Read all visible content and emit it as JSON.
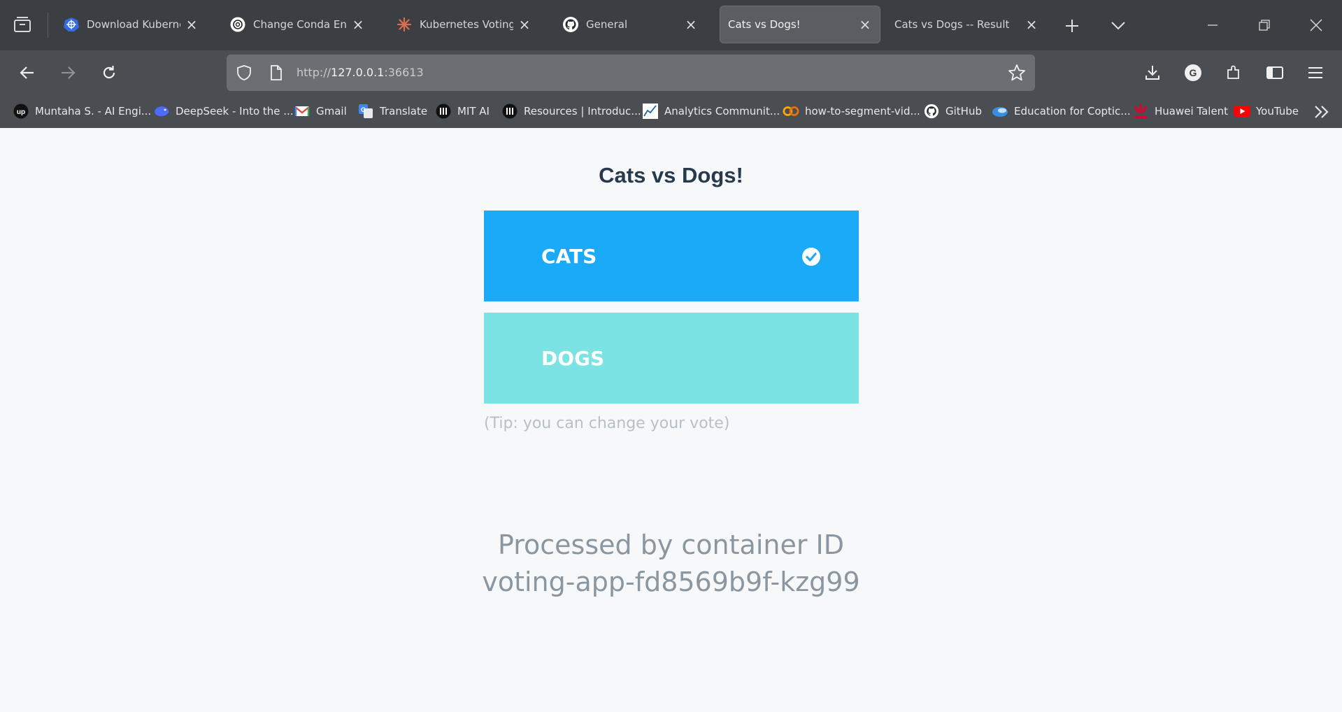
{
  "browser": {
    "tabs": [
      {
        "title": "Download Kubernetes",
        "icon": "kubernetes-icon",
        "active": false
      },
      {
        "title": "Change Conda Environ",
        "icon": "openai-icon",
        "active": false
      },
      {
        "title": "Kubernetes Voting Ap",
        "icon": "claude-icon",
        "active": false
      },
      {
        "title": "General",
        "icon": "github-icon",
        "active": false
      },
      {
        "title": "Cats vs Dogs!",
        "icon": "",
        "active": true
      },
      {
        "title": "Cats vs Dogs -- Result",
        "icon": "",
        "active": false
      }
    ],
    "url": {
      "prefix": "http://",
      "host": "127.0.0.1",
      "port": ":36613"
    },
    "bookmarks": [
      {
        "label": "Muntaha S. - AI Engi...",
        "icon": "upwork-icon"
      },
      {
        "label": "DeepSeek - Into the ...",
        "icon": "deepseek-icon"
      },
      {
        "label": "Gmail",
        "icon": "gmail-icon"
      },
      {
        "label": "Translate",
        "icon": "translate-icon"
      },
      {
        "label": "MIT AI",
        "icon": "mit-icon"
      },
      {
        "label": "Resources | Introduc...",
        "icon": "mit-icon"
      },
      {
        "label": "Analytics Communit...",
        "icon": "analytics-icon"
      },
      {
        "label": "how-to-segment-vid...",
        "icon": "colab-icon"
      },
      {
        "label": "GitHub",
        "icon": "github-icon"
      },
      {
        "label": "Education for Coptic...",
        "icon": "education-icon"
      },
      {
        "label": "Huawei Talent",
        "icon": "huawei-icon"
      },
      {
        "label": "YouTube",
        "icon": "youtube-icon"
      }
    ]
  },
  "page": {
    "title": "Cats vs Dogs!",
    "options": [
      {
        "label": "CATS",
        "selected": true,
        "color": "#1aaaf8"
      },
      {
        "label": "DOGS",
        "selected": false,
        "color": "#7be3e3"
      }
    ],
    "tip": "(Tip: you can change your vote)",
    "processed_line1": "Processed by container ID",
    "processed_line2": "voting-app-fd8569b9f-kzg99"
  }
}
